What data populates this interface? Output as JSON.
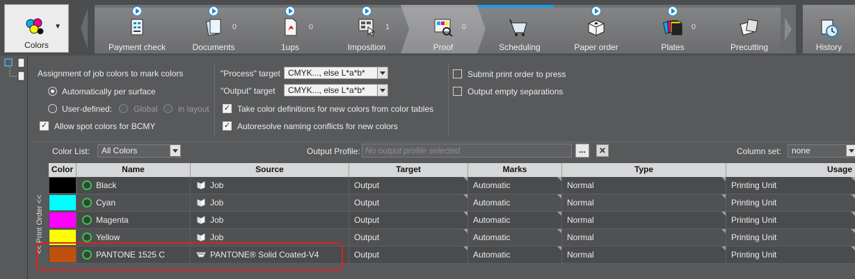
{
  "toolbar": {
    "colors_label": "Colors",
    "history_label": "History",
    "steps": [
      {
        "label": "Payment check",
        "count": ""
      },
      {
        "label": "Documents",
        "count": "0"
      },
      {
        "label": "1ups",
        "count": "0"
      },
      {
        "label": "Imposition",
        "count": "1"
      },
      {
        "label": "Proof",
        "count": "0"
      },
      {
        "label": "Scheduling",
        "count": ""
      },
      {
        "label": "Paper order",
        "count": ""
      },
      {
        "label": "Plates",
        "count": "0"
      },
      {
        "label": "Precutting",
        "count": ""
      }
    ]
  },
  "options": {
    "assignment_label": "Assignment of job colors to mark colors",
    "auto_per_surface": "Automatically per surface",
    "user_defined": "User-defined:",
    "global": "Global",
    "in_layout": "in layout",
    "allow_spot": "Allow spot colors for BCMY",
    "process_target_label": "\"Process\" target",
    "process_target_value": "CMYK..., else L*a*b*",
    "output_target_label": "\"Output\" target",
    "output_target_value": "CMYK..., else L*a*b*",
    "take_color_defs": "Take color definitions for new colors from color tables",
    "autoresolve": "Autoresolve naming conflicts for new colors",
    "submit_print_order": "Submit print order to press",
    "output_empty_seps": "Output empty separations"
  },
  "filter": {
    "color_list_label": "Color List:",
    "color_list_value": "All Colors",
    "output_profile_label": "Output Profile:",
    "output_profile_placeholder": "No output profile selected",
    "browse_label": "...",
    "clear_label": "✕",
    "column_set_label": "Column set:",
    "column_set_value": "none"
  },
  "side_tab_label": "<< Print Order <<",
  "table": {
    "headers": [
      "Color",
      "Name",
      "Source",
      "Target",
      "Marks",
      "Type",
      "Usage"
    ],
    "rows": [
      {
        "color": "#000000",
        "name": "Black",
        "source": "Job",
        "target": "Output",
        "marks": "Automatic",
        "type": "Normal",
        "usage": "Printing Unit"
      },
      {
        "color": "#00ffff",
        "name": "Cyan",
        "source": "Job",
        "target": "Output",
        "marks": "Automatic",
        "type": "Normal",
        "usage": "Printing Unit"
      },
      {
        "color": "#ff00ff",
        "name": "Magenta",
        "source": "Job",
        "target": "Output",
        "marks": "Automatic",
        "type": "Normal",
        "usage": "Printing Unit"
      },
      {
        "color": "#ffff00",
        "name": "Yellow",
        "source": "Job",
        "target": "Output",
        "marks": "Automatic",
        "type": "Normal",
        "usage": "Printing Unit"
      },
      {
        "color": "#c0500f",
        "name": "PANTONE 1525 C",
        "source": "PANTONE® Solid Coated-V4",
        "target": "Output",
        "marks": "Automatic",
        "type": "Normal",
        "usage": "Printing Unit"
      }
    ]
  },
  "colors": {
    "status_green": "#2ecc40",
    "highlight_red": "#e02020",
    "scheduling_accent": "#1e9be0"
  }
}
